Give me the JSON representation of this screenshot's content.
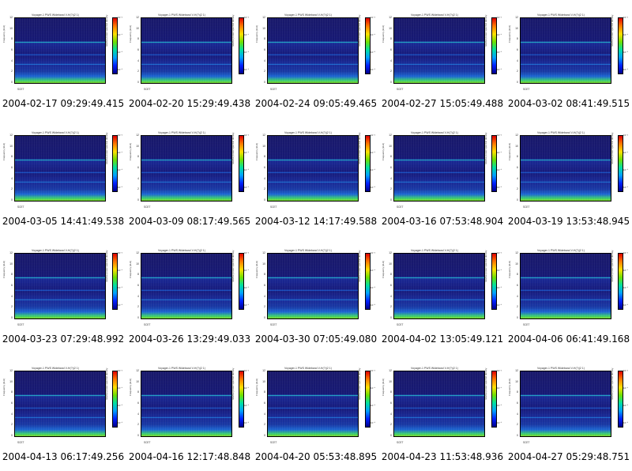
{
  "panels": [
    {
      "caption": "2004-02-17 09:29:49.415",
      "plot_title": "Voyager-1 PWS Wideband V-H(?)(2 1)"
    },
    {
      "caption": "2004-02-20 15:29:49.438",
      "plot_title": "Voyager-1 PWS Wideband V-H(?)(2 1)"
    },
    {
      "caption": "2004-02-24 09:05:49.465",
      "plot_title": "Voyager-1 PWS Wideband V-H(?)(2 1)"
    },
    {
      "caption": "2004-02-27 15:05:49.488",
      "plot_title": "Voyager-1 PWS Wideband V-H(?)(2 1)"
    },
    {
      "caption": "2004-03-02 08:41:49.515",
      "plot_title": "Voyager-1 PWS Wideband V-H(?)(2 1)"
    },
    {
      "caption": "2004-03-05 14:41:49.538",
      "plot_title": "Voyager-1 PWS Wideband V-H(?)(2 1)"
    },
    {
      "caption": "2004-03-09 08:17:49.565",
      "plot_title": "Voyager-1 PWS Wideband V-H(?)(2 1)"
    },
    {
      "caption": "2004-03-12 14:17:49.588",
      "plot_title": "Voyager-1 PWS Wideband V-H(?)(2 1)"
    },
    {
      "caption": "2004-03-16 07:53:48.904",
      "plot_title": "Voyager-1 PWS Wideband V-H(?)(2 1)"
    },
    {
      "caption": "2004-03-19 13:53:48.945",
      "plot_title": "Voyager-1 PWS Wideband V-H(?)(2 1)"
    },
    {
      "caption": "2004-03-23 07:29:48.992",
      "plot_title": "Voyager-1 PWS Wideband V-H(?)(2 1)"
    },
    {
      "caption": "2004-03-26 13:29:49.033",
      "plot_title": "Voyager-1 PWS Wideband V-H(?)(2 1)"
    },
    {
      "caption": "2004-03-30 07:05:49.080",
      "plot_title": "Voyager-1 PWS Wideband V-H(?)(2 1)"
    },
    {
      "caption": "2004-04-02 13:05:49.121",
      "plot_title": "Voyager-1 PWS Wideband V-H(?)(2 1)"
    },
    {
      "caption": "2004-04-06 06:41:49.168",
      "plot_title": "Voyager-1 PWS Wideband V-H(?)(2 1)"
    },
    {
      "caption": "2004-04-13 06:17:49.256",
      "plot_title": "Voyager-1 PWS Wideband V-H(?)(2 1)"
    },
    {
      "caption": "2004-04-16 12:17:48.848",
      "plot_title": "Voyager-1 PWS Wideband V-H(?)(2 1)"
    },
    {
      "caption": "2004-04-20 05:53:48.895",
      "plot_title": "Voyager-1 PWS Wideband V-H(?)(2 1)"
    },
    {
      "caption": "2004-04-23 11:53:48.936",
      "plot_title": "Voyager-1 PWS Wideband V-H(?)(2 1)"
    },
    {
      "caption": "2004-04-27 05:29:48.751",
      "plot_title": "Voyager-1 PWS Wideband V-H(?)(2 1)"
    }
  ],
  "y_ticks": [
    "12",
    "10",
    "8",
    "6",
    "4",
    "2",
    "0"
  ],
  "y_axis_label": "Frequency (kHz)",
  "colorbar_label": "relative power spectral density",
  "colorbar_ticks": [
    "10⁻³",
    "10⁻⁴",
    "10⁻⁵",
    "10⁻⁶"
  ],
  "utc_label": "SCET",
  "colors": {
    "background": "#ffffff",
    "caption": "#000000"
  }
}
